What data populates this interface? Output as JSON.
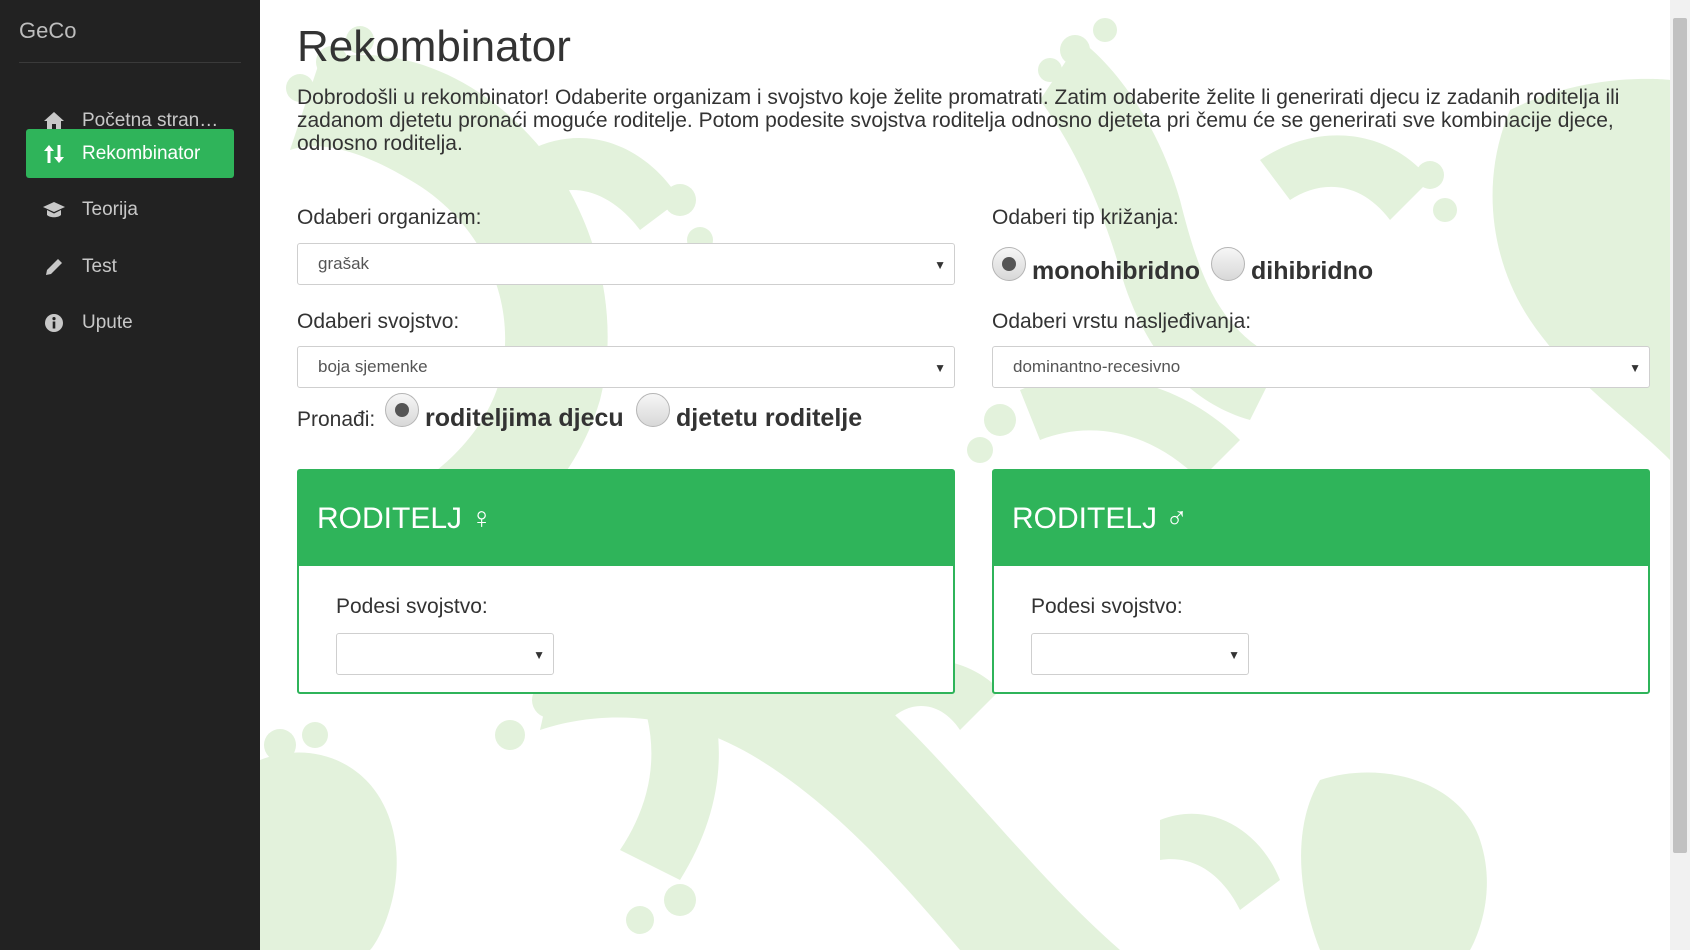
{
  "sidebar": {
    "brand": "GeCo",
    "items": [
      {
        "label": "Početna stran…",
        "icon": "home-icon",
        "active": false
      },
      {
        "label": "Rekombinator",
        "icon": "sort-arrows-icon",
        "active": true
      },
      {
        "label": "Teorija",
        "icon": "graduation-cap-icon",
        "active": false
      },
      {
        "label": "Test",
        "icon": "pencil-icon",
        "active": false
      },
      {
        "label": "Upute",
        "icon": "info-icon",
        "active": false
      }
    ]
  },
  "main": {
    "title": "Rekombinator",
    "intro": "Dobrodošli u rekombinator! Odaberite organizam i svojstvo koje želite promatrati. Zatim odaberite želite li generirati djecu iz zadanih roditelja ili zadanom djetetu pronaći moguće roditelje. Potom podesite svojstva roditelja odnosno djeteta pri čemu će se generirati sve kombinacije djece, odnosno roditelja.",
    "organism": {
      "label": "Odaberi organizam:",
      "value": "grašak"
    },
    "trait": {
      "label": "Odaberi svojstvo:",
      "value": "boja sjemenke"
    },
    "cross_type": {
      "label": "Odaberi tip križanja:",
      "options": [
        "monohibridno",
        "dihibridno"
      ],
      "selected": "monohibridno"
    },
    "inheritance": {
      "label": "Odaberi vrstu nasljeđivanja:",
      "value": "dominantno-recesivno"
    },
    "find": {
      "label": "Pronađi:",
      "options": [
        "roditeljima djecu",
        "djetetu roditelje"
      ],
      "selected": "roditeljima djecu"
    },
    "panels": [
      {
        "title": "RODITELJ ♀",
        "sub_label": "Podesi svojstvo:",
        "value": ""
      },
      {
        "title": "RODITELJ ♂",
        "sub_label": "Podesi svojstvo:",
        "value": ""
      }
    ]
  },
  "colors": {
    "accent": "#2fb45a",
    "sidebar_bg": "#222222",
    "background_art": "#e3f2dc"
  }
}
